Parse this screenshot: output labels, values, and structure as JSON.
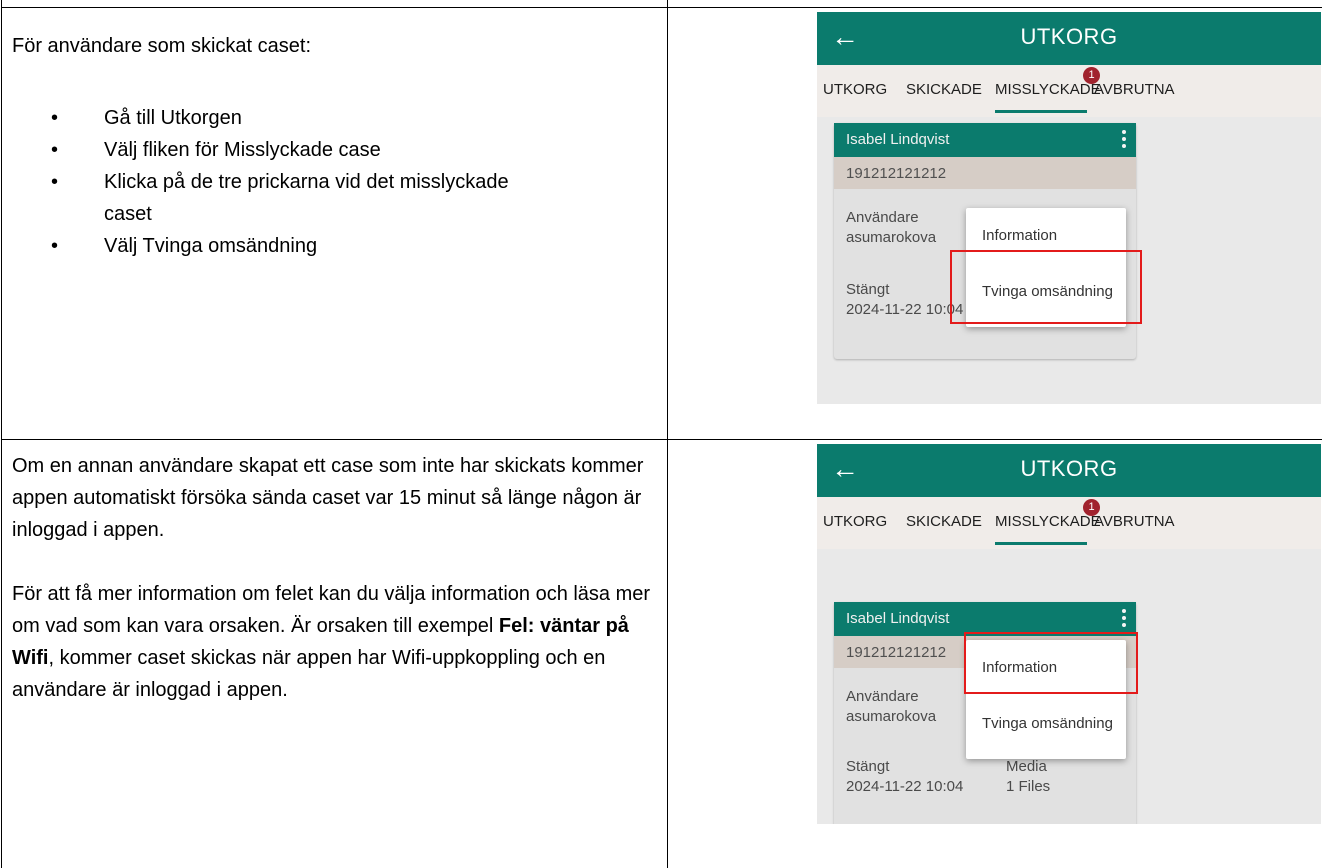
{
  "row1": {
    "heading": "För användare som skickat caset:",
    "bullets": [
      "Gå till Utkorgen",
      "Välj fliken för Misslyckade case",
      "Klicka på de tre prickarna vid det misslyckade caset",
      "Välj Tvinga omsändning"
    ]
  },
  "row2": {
    "para1": "Om en annan användare skapat ett case som inte har skickats kommer appen automatiskt försöka sända caset var 15 minut så länge någon är inloggad i appen.",
    "para2_start": "För att få mer information om felet kan du välja information och läsa mer om vad som kan vara orsaken. Är orsaken till exempel ",
    "para2_bold": "Fel: väntar på Wifi",
    "para2_end": ", kommer caset skickas när appen har Wifi-uppkoppling och en användare är inloggad i appen."
  },
  "app": {
    "back_icon": "arrow-left-icon",
    "title": "UTKORG",
    "tabs": [
      "UTKORG",
      "SKICKADE",
      "MISSLYCKADE",
      "AVBRUTNA"
    ],
    "active_tab": "MISSLYCKADE",
    "badge_count": "1",
    "card": {
      "name": "Isabel Lindqvist",
      "id": "191212121212",
      "user_label": "Användare",
      "user_value": "asumarokova",
      "closed_label": "Stängt",
      "closed_value": "2024-11-22 10:04",
      "media_label": "Media",
      "media_value": "1 Files"
    },
    "menu": {
      "information": "Information",
      "force_resend": "Tvinga omsändning"
    },
    "accent": "#0b7b6d",
    "badge_color": "#a1232e",
    "highlight_color": "#e31b1b"
  }
}
